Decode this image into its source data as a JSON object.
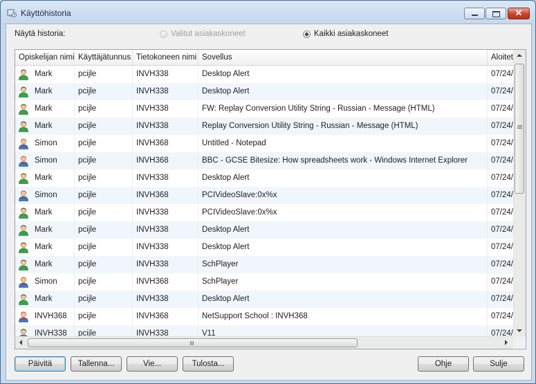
{
  "window": {
    "title": "Käyttöhistoria"
  },
  "filter": {
    "label": "Näytä historia:",
    "options": [
      {
        "label": "Valitut asiakaskoneet",
        "checked": false,
        "disabled": true
      },
      {
        "label": "Kaikki asiakaskoneet",
        "checked": true,
        "disabled": false
      }
    ]
  },
  "table": {
    "columns": [
      "Opiskelijan nimi",
      "Käyttäjätunnus",
      "Tietokoneen nimi",
      "Sovellus",
      "Aloitet"
    ],
    "rows": [
      {
        "icon": "student-green-icon",
        "name": "Mark",
        "user": "pcijle",
        "computer": "INVH338",
        "app": "Desktop Alert",
        "start": "07/24/"
      },
      {
        "icon": "student-green-icon",
        "name": "Mark",
        "user": "pcijle",
        "computer": "INVH338",
        "app": "Desktop Alert",
        "start": "07/24/"
      },
      {
        "icon": "student-green-icon",
        "name": "Mark",
        "user": "pcijle",
        "computer": "INVH338",
        "app": "FW: Replay Conversion Utility String - Russian - Message (HTML)",
        "start": "07/24/"
      },
      {
        "icon": "student-green-icon",
        "name": "Mark",
        "user": "pcijle",
        "computer": "INVH338",
        "app": "Replay Conversion Utility String - Russian - Message (HTML)",
        "start": "07/24/"
      },
      {
        "icon": "student-blue-icon",
        "name": "Simon",
        "user": "pcijle",
        "computer": "INVH368",
        "app": "Untitled - Notepad",
        "start": "07/24/"
      },
      {
        "icon": "student-blue-icon",
        "name": "Simon",
        "user": "pcijle",
        "computer": "INVH368",
        "app": "BBC - GCSE Bitesize: How spreadsheets work - Windows Internet Explorer",
        "start": "07/24/"
      },
      {
        "icon": "student-green-icon",
        "name": "Mark",
        "user": "pcijle",
        "computer": "INVH338",
        "app": "Desktop Alert",
        "start": "07/24/"
      },
      {
        "icon": "student-blue-icon",
        "name": "Simon",
        "user": "pcijle",
        "computer": "INVH368",
        "app": "PCIVideoSlave:0x%x",
        "start": "07/24/"
      },
      {
        "icon": "student-green-icon",
        "name": "Mark",
        "user": "pcijle",
        "computer": "INVH338",
        "app": "PCIVideoSlave:0x%x",
        "start": "07/24/"
      },
      {
        "icon": "student-green-icon",
        "name": "Mark",
        "user": "pcijle",
        "computer": "INVH338",
        "app": "Desktop Alert",
        "start": "07/24/"
      },
      {
        "icon": "student-green-icon",
        "name": "Mark",
        "user": "pcijle",
        "computer": "INVH338",
        "app": "Desktop Alert",
        "start": "07/24/"
      },
      {
        "icon": "student-green-icon",
        "name": "Mark",
        "user": "pcijle",
        "computer": "INVH338",
        "app": "SchPlayer",
        "start": "07/24/"
      },
      {
        "icon": "student-blue-icon",
        "name": "Simon",
        "user": "pcijle",
        "computer": "INVH368",
        "app": "SchPlayer",
        "start": "07/24/"
      },
      {
        "icon": "student-green-icon",
        "name": "Mark",
        "user": "pcijle",
        "computer": "INVH338",
        "app": "Desktop Alert",
        "start": "07/24/"
      },
      {
        "icon": "student-blue-icon",
        "name": "INVH368",
        "user": "pcijle",
        "computer": "INVH368",
        "app": "NetSupport School : INVH368",
        "start": "07/24/"
      },
      {
        "icon": "student-green-icon",
        "name": "INVH338",
        "user": "pcijle",
        "computer": "INVH338",
        "app": "V11",
        "start": "07/24/"
      }
    ]
  },
  "buttons": {
    "refresh": "Päivitä",
    "save": "Tallenna...",
    "export": "Vie...",
    "print": "Tulosta...",
    "help": "Ohje",
    "close": "Sulje"
  }
}
